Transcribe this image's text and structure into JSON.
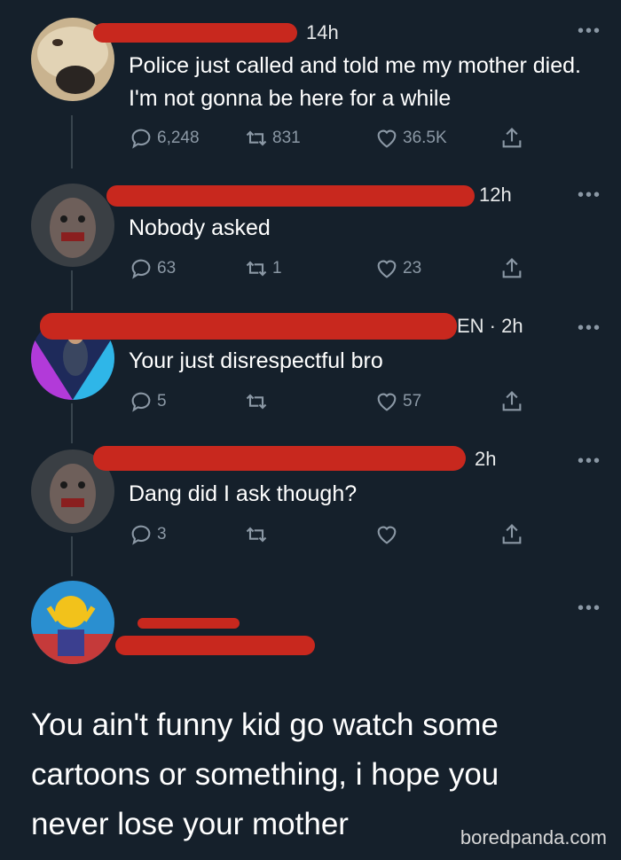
{
  "tweets": [
    {
      "time": "14h",
      "text": "Police just called and told me my mother died. I'm not gonna be here for a while",
      "replies": "6,248",
      "retweets": "831",
      "likes": "36.5K"
    },
    {
      "time": "12h",
      "text": "Nobody asked",
      "replies": "63",
      "retweets": "1",
      "likes": "23"
    },
    {
      "time": "EN · 2h",
      "text": "Your just disrespectful bro",
      "replies": "5",
      "retweets": "",
      "likes": "57"
    },
    {
      "time": "2h",
      "text": "Dang did I ask though?",
      "replies": "3",
      "retweets": "",
      "likes": ""
    }
  ],
  "reply": {
    "text": "You ain't funny kid go watch some cartoons or something, i hope you never lose your mother"
  },
  "more_label": "•••",
  "watermark": "boredpanda.com",
  "icons": {
    "reply": "reply-icon",
    "retweet": "retweet-icon",
    "like": "heart-icon",
    "share": "share-icon"
  },
  "colors": {
    "background": "#15202b",
    "redaction": "#c8281e",
    "muted": "#8b98a5"
  }
}
